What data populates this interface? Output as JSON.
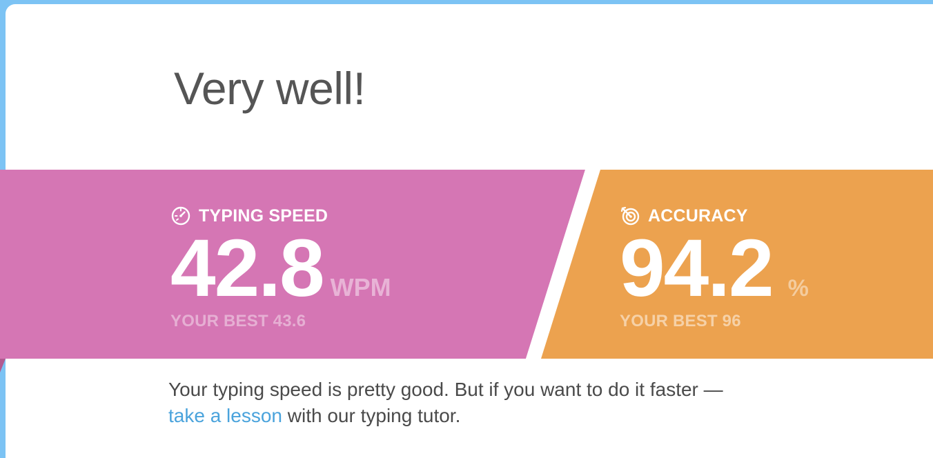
{
  "result": {
    "heading": "Very well!"
  },
  "speed": {
    "label": "TYPING SPEED",
    "value": "42.8",
    "unit": "WPM",
    "best": "YOUR BEST 43.6",
    "icon": "speedometer-icon",
    "color": "#d576b4"
  },
  "accuracy": {
    "label": "ACCURACY",
    "value": "94.2",
    "unit": "%",
    "best": "YOUR BEST 96",
    "icon": "target-icon",
    "color": "#eca24f"
  },
  "feedback": {
    "text_before": "Your typing speed is pretty good. But if you want to do it faster — ",
    "link_text": "take a lesson",
    "text_after": " with our typing tutor."
  },
  "colors": {
    "frame": "#7cc3f4",
    "card": "#ffffff",
    "heading_text": "#555555",
    "link": "#4aa3dc"
  }
}
